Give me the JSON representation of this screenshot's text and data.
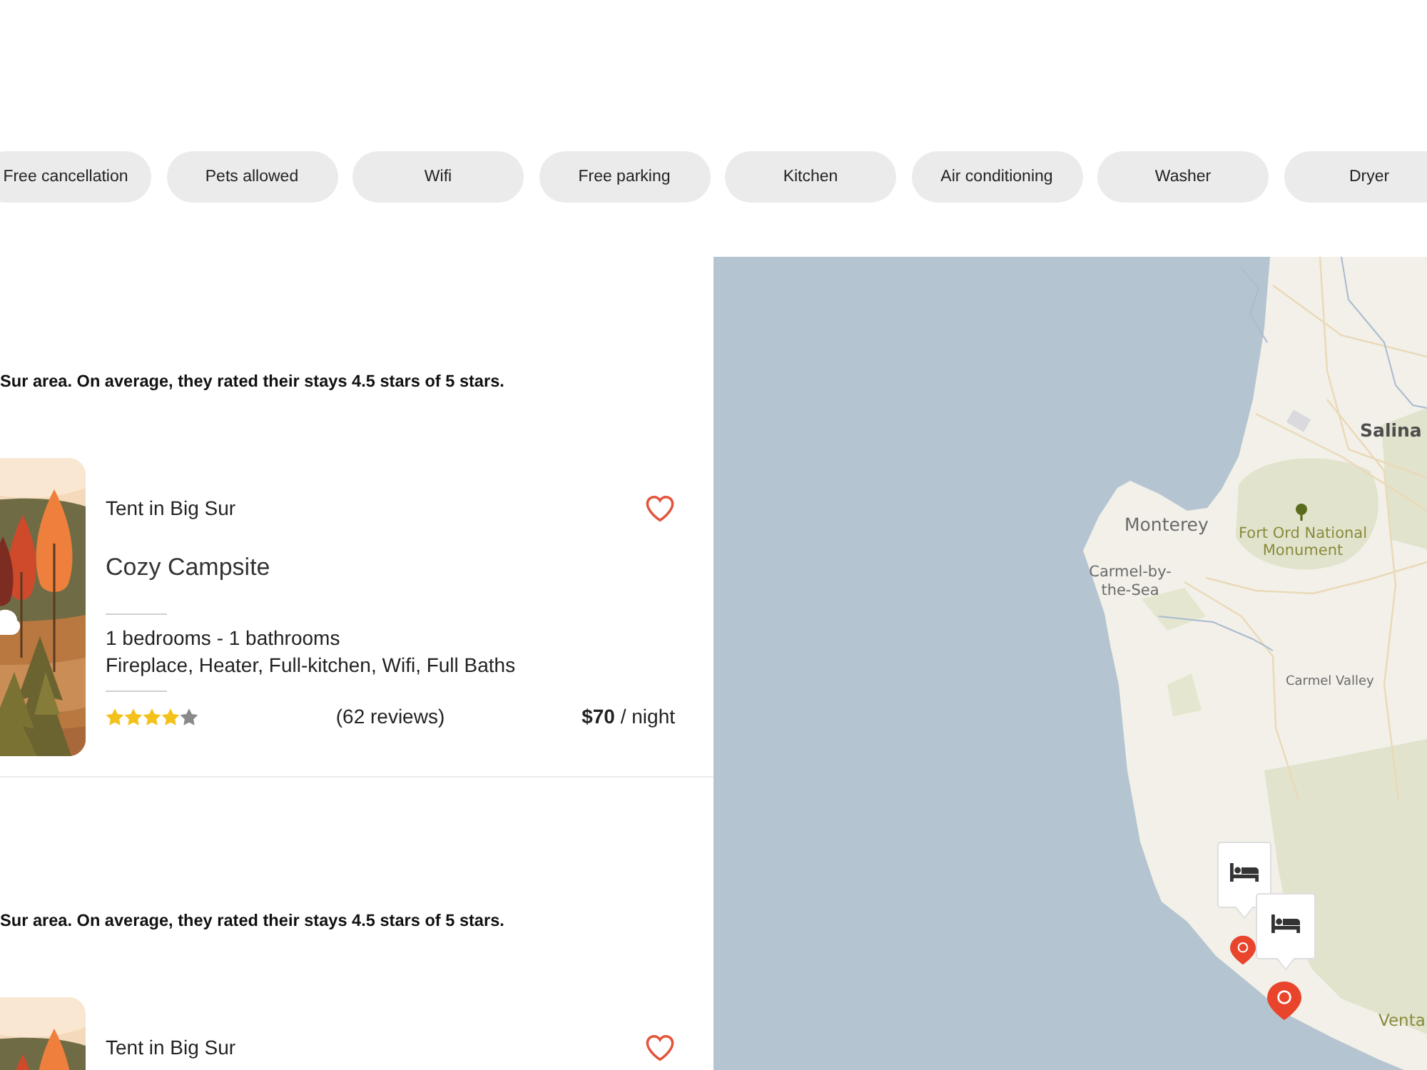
{
  "filters": [
    "Free cancellation",
    "Pets allowed",
    "Wifi",
    "Free parking",
    "Kitchen",
    "Air conditioning",
    "Washer",
    "Dryer"
  ],
  "listings": [
    {
      "summary": "Sur area. On average, they rated their stays 4.5 stars of 5 stars.",
      "type": "Tent in Big Sur",
      "name": "Cozy Campsite",
      "rooms": "1 bedrooms - 1 bathrooms",
      "amenities": "Fireplace, Heater, Full-kitchen, Wifi, Full Baths",
      "stars": 4,
      "reviews": "(62 reviews)",
      "price": "**$70** / night"
    },
    {
      "summary": "Sur area. On average, they rated their stays 4.5 stars of 5 stars.",
      "type": "Tent in Big Sur"
    }
  ],
  "map": {
    "labels": [
      {
        "kind": "city",
        "text": "Salina"
      },
      {
        "kind": "town",
        "text": "Monterey"
      },
      {
        "kind": "park",
        "text": "Fort Ord National Monument"
      },
      {
        "kind": "town",
        "text": "Carmel-by-the-Sea"
      },
      {
        "kind": "town",
        "text": "Carmel Valley"
      },
      {
        "kind": "park",
        "text": "Venta"
      }
    ],
    "markers": [
      {
        "kind": "lodging"
      },
      {
        "kind": "lodging"
      },
      {
        "kind": "pin"
      },
      {
        "kind": "pin"
      }
    ]
  }
}
